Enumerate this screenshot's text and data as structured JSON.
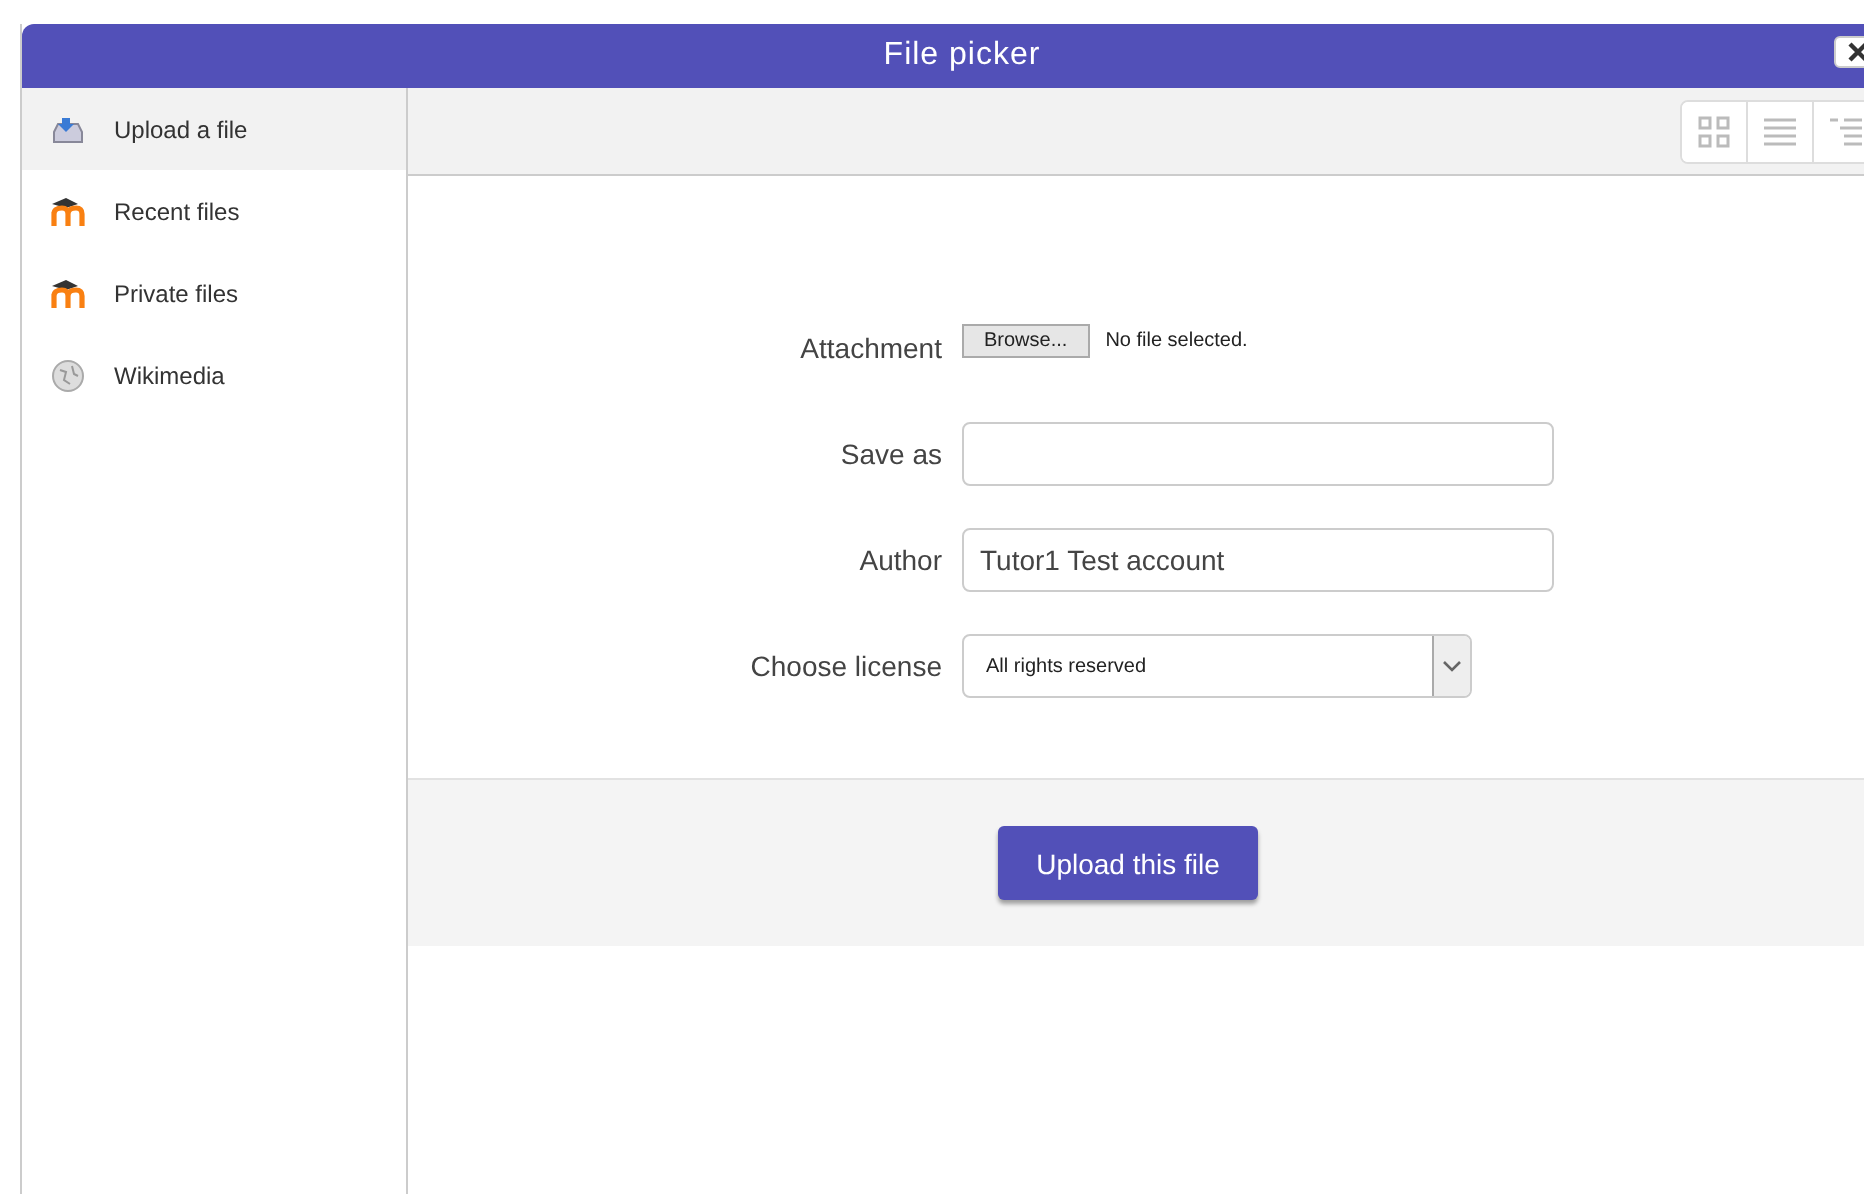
{
  "window": {
    "title": "File picker"
  },
  "sidebar": {
    "items": [
      {
        "label": "Upload a file",
        "kind": "upload",
        "selected": true
      },
      {
        "label": "Recent files",
        "kind": "moodle",
        "selected": false
      },
      {
        "label": "Private files",
        "kind": "moodle",
        "selected": false
      },
      {
        "label": "Wikimedia",
        "kind": "wikimedia",
        "selected": false
      }
    ]
  },
  "toolbar": {
    "views": [
      {
        "kind": "icons"
      },
      {
        "kind": "list"
      },
      {
        "kind": "tree"
      }
    ]
  },
  "form": {
    "attachment": {
      "label": "Attachment",
      "button": "Browse...",
      "status": "No file selected."
    },
    "save_as": {
      "label": "Save as"
    },
    "author": {
      "label": "Author",
      "value": "Tutor1 Test account"
    },
    "license": {
      "label": "Choose license",
      "value": "All rights reserved"
    }
  },
  "footer": {
    "button": "Upload this file"
  }
}
